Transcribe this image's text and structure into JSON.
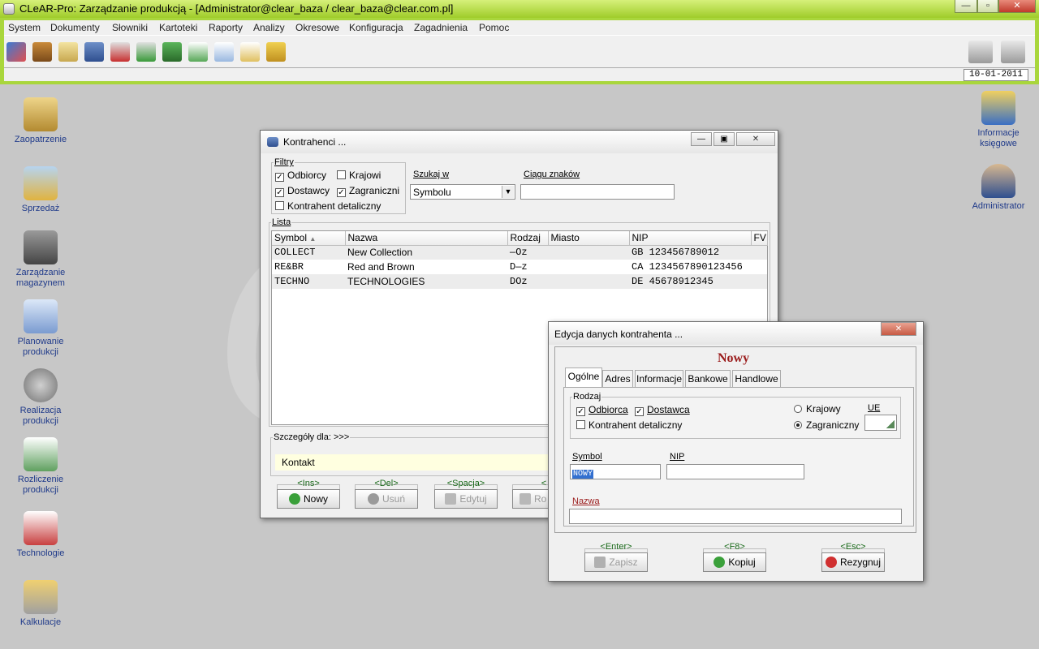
{
  "app": {
    "title": "CLeAR-Pro:  Zarządzanie produkcją - [Administrator@clear_baza / clear_baza@clear.com.pl]",
    "date": "10-01-2011"
  },
  "menu": [
    "System",
    "Dokumenty",
    "Słowniki",
    "Kartoteki",
    "Raporty",
    "Analizy",
    "Okresowe",
    "Konfiguracja",
    "Zagadnienia",
    "Pomoc"
  ],
  "desktop": {
    "left": [
      {
        "name": "zaopatrzenie",
        "label": "Zaopatrzenie",
        "color": "#c9a24a"
      },
      {
        "name": "sprzedaz",
        "label": "Sprzedaż",
        "color": "#e0b340"
      },
      {
        "name": "zarzadzanie-magazynem",
        "label": "Zarządzanie magazynem",
        "color": "#6d6d6d"
      },
      {
        "name": "planowanie-produkcji",
        "label": "Planowanie produkcji",
        "color": "#7a9bd0"
      },
      {
        "name": "realizacja-produkcji",
        "label": "Realizacja produkcji",
        "color": "#8a8a8a"
      },
      {
        "name": "rozliczenie-produkcji",
        "label": "Rozliczenie produkcji",
        "color": "#5fa05f"
      },
      {
        "name": "technologie",
        "label": "Technologie",
        "color": "#c84040"
      },
      {
        "name": "kalkulacje",
        "label": "Kalkulacje",
        "color": "#d6a24a"
      }
    ],
    "right": [
      {
        "name": "informacje-ksiegowe",
        "label": "Informacje księgowe",
        "color": "#3a6fc4"
      },
      {
        "name": "administrator",
        "label": "Administrator",
        "color": "#2f4f8f"
      }
    ]
  },
  "watermark": "C",
  "kontrahenci": {
    "title": "Kontrahenci ...",
    "filtry_legend": "Filtry",
    "odbiorcy": "Odbiorcy",
    "dostawcy": "Dostawcy",
    "krajowi": "Krajowi",
    "zagraniczni": "Zagraniczni",
    "detaliczny": "Kontrahent detaliczny",
    "szukaj_legend": "Szukaj w",
    "szukaj_value": "Symbolu",
    "ciagu_legend": "Ciągu znaków",
    "lista_legend": "Lista",
    "columns": [
      "Symbol",
      "Nazwa",
      "Rodzaj",
      "Miasto",
      "NIP",
      "FV"
    ],
    "rows": [
      {
        "symbol": "COLLECT",
        "nazwa": "New Collection",
        "rodzaj": "—Oz",
        "miasto": "",
        "nip": "GB 123456789012",
        "fv": ""
      },
      {
        "symbol": "RE&BR",
        "nazwa": "Red and Brown",
        "rodzaj": "D—z",
        "miasto": "",
        "nip": "CA 1234567890123456",
        "fv": ""
      },
      {
        "symbol": "TECHNO",
        "nazwa": "TECHNOLOGIES",
        "rodzaj": "DOz",
        "miasto": "",
        "nip": "DE 45678912345",
        "fv": ""
      }
    ],
    "szczegoly_legend": "Szczegóły dla: >>>",
    "kontakt": "Kontakt",
    "buttons": [
      {
        "key": "<Ins>",
        "label": "Nowy"
      },
      {
        "key": "<Del>",
        "label": "Usuń"
      },
      {
        "key": "<Spacja>",
        "label": "Edytuj"
      },
      {
        "key": "<",
        "label": "Ro"
      }
    ]
  },
  "edycja": {
    "title": "Edycja danych kontrahenta ...",
    "heading": "Nowy",
    "tabs": [
      "Ogólne",
      "Adres",
      "Informacje",
      "Bankowe",
      "Handlowe"
    ],
    "rodzaj_legend": "Rodzaj",
    "odbiorca": "Odbiorca",
    "dostawca": "Dostawca",
    "detaliczny": "Kontrahent detaliczny",
    "krajowy": "Krajowy",
    "zagraniczny": "Zagraniczny",
    "ue_legend": "UE",
    "symbol_legend": "Symbol",
    "symbol_value": "NOWY",
    "nip_legend": "NIP",
    "nazwa_legend": "Nazwa",
    "buttons": [
      {
        "key": "<Enter>",
        "label": "Zapisz"
      },
      {
        "key": "<F8>",
        "label": "Kopiuj"
      },
      {
        "key": "<Esc>",
        "label": "Rezygnuj"
      }
    ]
  }
}
